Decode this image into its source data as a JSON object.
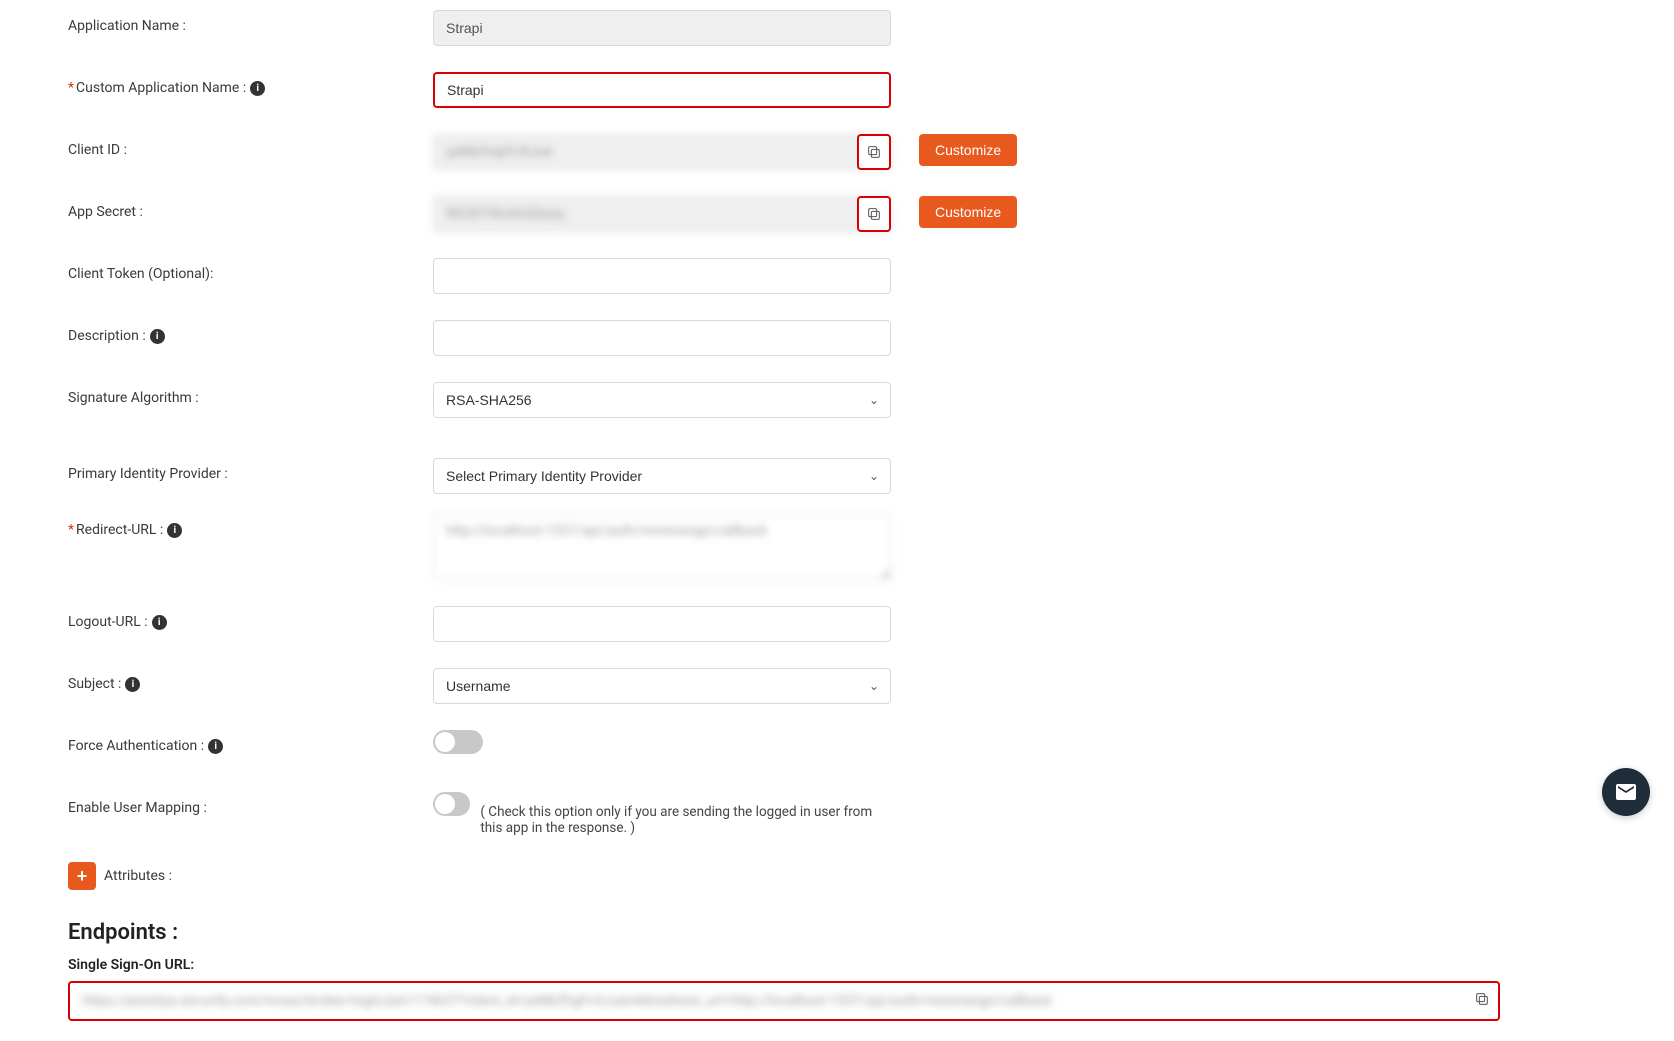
{
  "labels": {
    "application_name": "Application Name :",
    "custom_application_name": "Custom Application Name :",
    "client_id": "Client ID :",
    "app_secret": "App Secret :",
    "client_token": "Client Token (Optional):",
    "description": "Description :",
    "signature_algorithm": "Signature Algorithm :",
    "primary_identity_provider": "Primary Identity Provider :",
    "redirect_url": "Redirect-URL :",
    "logout_url": "Logout-URL :",
    "subject": "Subject :",
    "force_authentication": "Force Authentication :",
    "enable_user_mapping": "Enable User Mapping :",
    "attributes": "Attributes :"
  },
  "values": {
    "application_name": "Strapi",
    "custom_application_name": "Strapi",
    "client_id_blurred": "yaNkZmpFcXJue",
    "app_secret_blurred": "RK2DTWcSnG0azq",
    "client_token": "",
    "description": "",
    "signature_algorithm": "RSA-SHA256",
    "primary_identity_provider": "Select Primary Identity Provider",
    "redirect_url_blurred": "http://localhost:1337/api/auth/miniorange/callback",
    "logout_url": "",
    "subject": "Username",
    "sso_url_blurred": "https://preshya.xecurify.com/moas/broker/login/jwt/174637?client_id=yaNkZhgFcXJuemkbrednext_url=http://localhost:1337/api/auth/miniorange/callback"
  },
  "buttons": {
    "customize": "Customize"
  },
  "helper": {
    "user_mapping": "( Check this option only if you are sending the logged in user from this app in the response. )"
  },
  "sections": {
    "endpoints": "Endpoints :",
    "sso_url": "Single Sign-On URL:"
  }
}
